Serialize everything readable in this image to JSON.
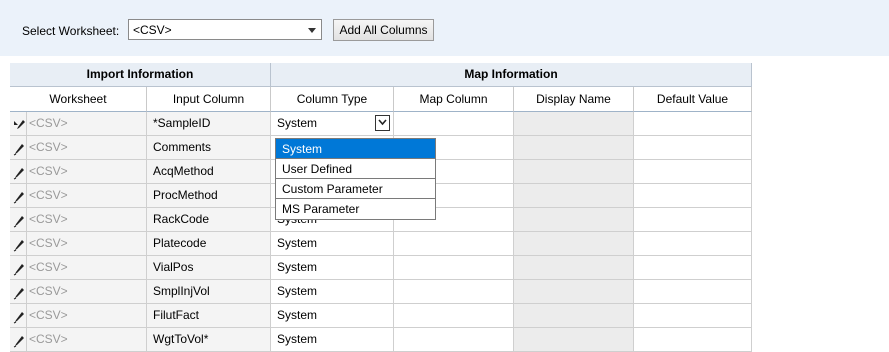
{
  "toolbar": {
    "select_worksheet_label": "Select Worksheet:",
    "worksheet_value": "<CSV>",
    "add_all_columns_label": "Add All Columns"
  },
  "grid": {
    "group_headers": {
      "import": "Import Information",
      "map": "Map Information"
    },
    "columns": [
      "Worksheet",
      "Input Column",
      "Column Type",
      "Map Column",
      "Display Name",
      "Default Value"
    ],
    "rows": [
      {
        "worksheet": "<CSV>",
        "input": "*SampleID",
        "type": "System",
        "map": "",
        "display": "",
        "default": ""
      },
      {
        "worksheet": "<CSV>",
        "input": "Comments",
        "type": "",
        "map": "",
        "display": "",
        "default": ""
      },
      {
        "worksheet": "<CSV>",
        "input": "AcqMethod",
        "type": "",
        "map": "",
        "display": "",
        "default": ""
      },
      {
        "worksheet": "<CSV>",
        "input": "ProcMethod",
        "type": "",
        "map": "",
        "display": "",
        "default": ""
      },
      {
        "worksheet": "<CSV>",
        "input": "RackCode",
        "type": "System",
        "map": "",
        "display": "",
        "default": ""
      },
      {
        "worksheet": "<CSV>",
        "input": "Platecode",
        "type": "System",
        "map": "",
        "display": "",
        "default": ""
      },
      {
        "worksheet": "<CSV>",
        "input": "VialPos",
        "type": "System",
        "map": "",
        "display": "",
        "default": ""
      },
      {
        "worksheet": "<CSV>",
        "input": "SmplInjVol",
        "type": "System",
        "map": "",
        "display": "",
        "default": ""
      },
      {
        "worksheet": "<CSV>",
        "input": "FilutFact",
        "type": "System",
        "map": "",
        "display": "",
        "default": ""
      },
      {
        "worksheet": "<CSV>",
        "input": "WgtToVol*",
        "type": "System",
        "map": "",
        "display": "",
        "default": ""
      }
    ]
  },
  "column_type_dropdown": {
    "options": [
      "System",
      "User Defined",
      "Custom Parameter",
      "MS Parameter"
    ],
    "selected": "System"
  },
  "colors": {
    "toolbar_bg": "#ebf2fa",
    "selection_blue": "#0078d7",
    "header_bg": "#e8eef5"
  }
}
